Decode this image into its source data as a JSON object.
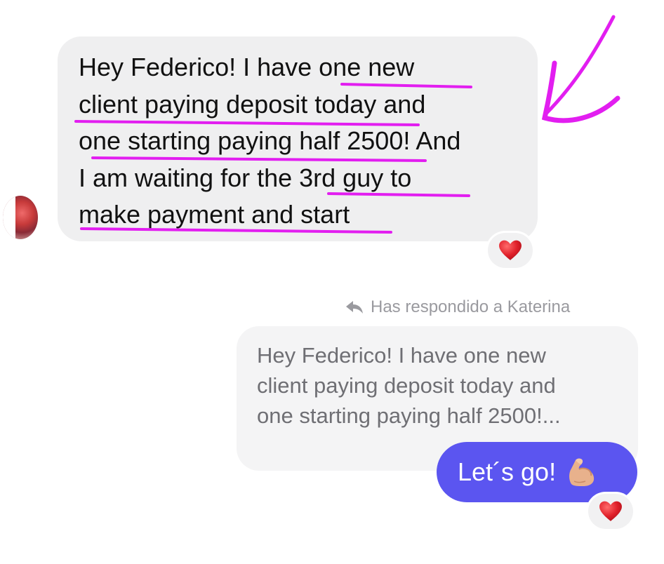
{
  "incoming_message": {
    "lines": [
      "Hey Federico! I have one new",
      "client paying deposit today and",
      "one starting paying half 2500! And",
      "I am waiting for the 3rd guy to",
      "make payment and start"
    ],
    "reaction": "heart-emoji"
  },
  "reply_context": {
    "label": "Has respondido a Katerina",
    "icon": "reply-arrow-icon",
    "quoted_lines": [
      "Hey Federico! I have one new",
      "client paying deposit today and",
      "one starting paying half 2500!..."
    ]
  },
  "outgoing_message": {
    "text": "Let´s go!",
    "emoji": "flexed-biceps-emoji",
    "reaction": "heart-emoji"
  },
  "colors": {
    "incoming_bubble": "#efeff0",
    "outgoing_bubble": "#5b55f0",
    "annotation": "#e21ef0",
    "heart": "#e0202a"
  }
}
